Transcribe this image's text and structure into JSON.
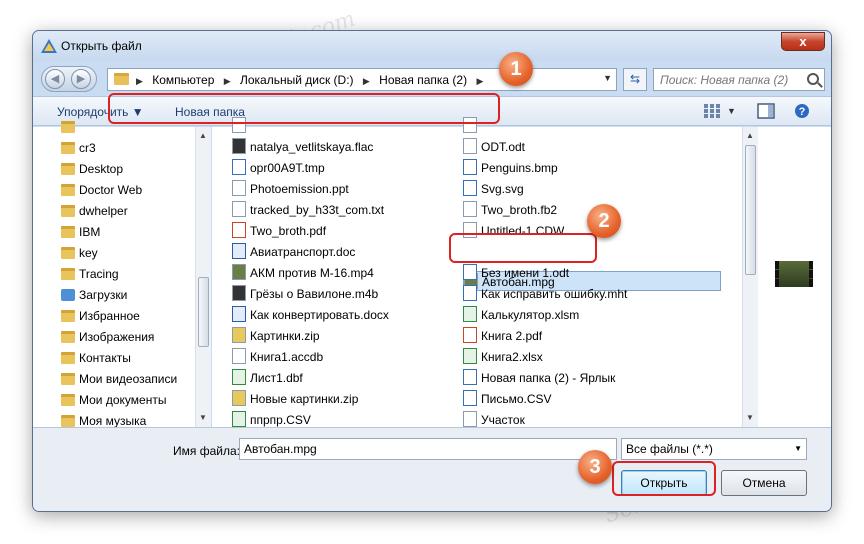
{
  "window": {
    "title": "Открыть файл",
    "close_label": "x"
  },
  "nav": {
    "breadcrumbs": [
      "Компьютер",
      "Локальный диск (D:)",
      "Новая папка (2)"
    ],
    "search_placeholder": "Поиск: Новая папка (2)"
  },
  "toolbar": {
    "organize_label": "Упорядочить ▼",
    "new_folder_label": "Новая папка"
  },
  "sidebar": {
    "items": [
      "cr3",
      "Desktop",
      "Doctor Web",
      "dwhelper",
      "IBM",
      "key",
      "Tracing",
      "Загрузки",
      "Избранное",
      "Изображения",
      "Контакты",
      "Мои видеозаписи",
      "Мои документы",
      "Моя музыка"
    ]
  },
  "files": {
    "col1": [
      "natalya_vetlitskaya.flac",
      "opr00A9T.tmp",
      "Photoemission.ppt",
      "tracked_by_h33t_com.txt",
      "Two_broth.pdf",
      "Авиатранспорт.doc",
      "АКМ против М-16.mp4",
      "Грёзы о Вавилоне.m4b",
      "Как конвертировать.docx",
      "Картинки.zip",
      "Книга1.accdb",
      "Лист1.dbf",
      "Новые картинки.zip",
      "ппрпр.CSV"
    ],
    "col2": [
      "ODT.odt",
      "Penguins.bmp",
      "Svg.svg",
      "Two_broth.fb2",
      "Untitled-1.CDW",
      "Автобан.mpg",
      "Без имени 1.odt",
      "Как исправить ошибку.mht",
      "Калькулятор.xlsm",
      "Книга 2.pdf",
      "Книга2.xlsx",
      "Новая папка (2) - Ярлык",
      "Письмо.CSV",
      "Участок"
    ],
    "selected": "Автобан.mpg"
  },
  "bottom": {
    "filename_label": "Имя файла:",
    "filename_value": "Автобан.mpg",
    "filetype_value": "Все файлы (*.*)",
    "open_label": "Открыть",
    "cancel_label": "Отмена"
  },
  "badges": [
    "1",
    "2",
    "3"
  ],
  "watermark": "Soringpcrepair.com"
}
